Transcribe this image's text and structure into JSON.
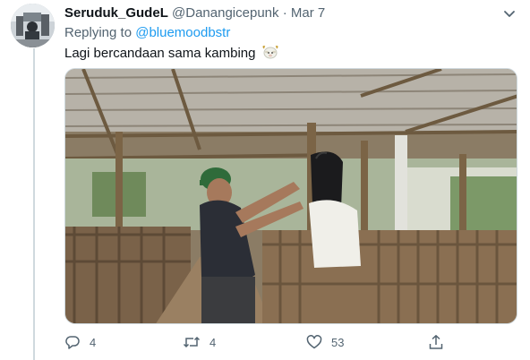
{
  "tweet": {
    "display_name": "Seruduk_GudeL",
    "handle": "@Danangicepunk",
    "separator": "·",
    "date": "Mar 7",
    "replying_prefix": "Replying to",
    "replying_to": "@bluemoodbstr",
    "text": "Lagi bercandaan sama kambing",
    "emoji_icon": "goat-face-icon"
  },
  "actions": {
    "reply_count": "4",
    "retweet_count": "4",
    "like_count": "53"
  },
  "icons": {
    "caret": "chevron-down-icon",
    "reply": "reply-icon",
    "retweet": "retweet-icon",
    "like": "heart-icon",
    "share": "share-icon"
  },
  "colors": {
    "link": "#1d9bf0",
    "secondary_text": "#536471",
    "text": "#0f1419",
    "border": "#cfd9de"
  }
}
